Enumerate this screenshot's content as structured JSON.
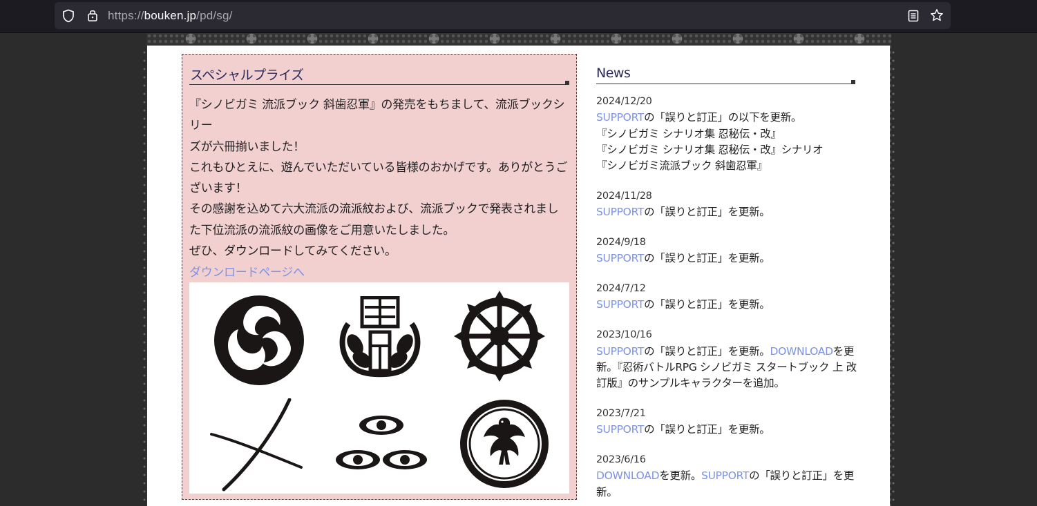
{
  "browser": {
    "url_scheme": "https://",
    "url_host": "bouken.jp",
    "url_path": "/pd/sg/"
  },
  "prize": {
    "title": "スペシャルプライズ",
    "body": [
      "『シノビガミ 流派ブック 斜歯忍軍』の発売をもちまして、流派ブックシリー",
      "ズが六冊揃いました！",
      "これもひとえに、遊んでいただいている皆様のおかげです。ありがとうご",
      "ざいます！",
      "その感謝を込めて六大流派の流派紋および、流派ブックで発表されまし",
      "た下位流派の流派紋の画像をご用意いたしました。",
      "ぜひ、ダウンロードしてみてください。"
    ],
    "download_link": "ダウンロードページへ"
  },
  "news": {
    "title": "News",
    "items": [
      {
        "date": "2024/12/20",
        "link": "SUPPORT",
        "text": "の「誤りと訂正」の以下を更新。",
        "extra": [
          "『シノビガミ シナリオ集 忍秘伝・改』",
          "『シノビガミ シナリオ集 忍秘伝・改』シナリオ",
          "『シノビガミ流派ブック 斜歯忍軍』"
        ]
      },
      {
        "date": "2024/11/28",
        "link": "SUPPORT",
        "text": "の「誤りと訂正」を更新。"
      },
      {
        "date": "2024/9/18",
        "link": "SUPPORT",
        "text": "の「誤りと訂正」を更新。"
      },
      {
        "date": "2024/7/12",
        "link": "SUPPORT",
        "text": "の「誤りと訂正」を更新。"
      },
      {
        "date": "2023/10/16",
        "link": "SUPPORT",
        "text": "の「誤りと訂正」を更新。",
        "link2": "DOWNLOAD",
        "text2": "を更新。『忍術バトルRPG シノビガミ スタートブック 上 改訂版』のサンプルキャラクターを追加。"
      },
      {
        "date": "2023/7/21",
        "link": "SUPPORT",
        "text": "の「誤りと訂正」を更新。"
      },
      {
        "date": "2023/6/16",
        "link": "DOWNLOAD",
        "text": "を更新。",
        "link2": "SUPPORT",
        "text2": "の「誤りと訂正」を更新。"
      }
    ]
  }
}
